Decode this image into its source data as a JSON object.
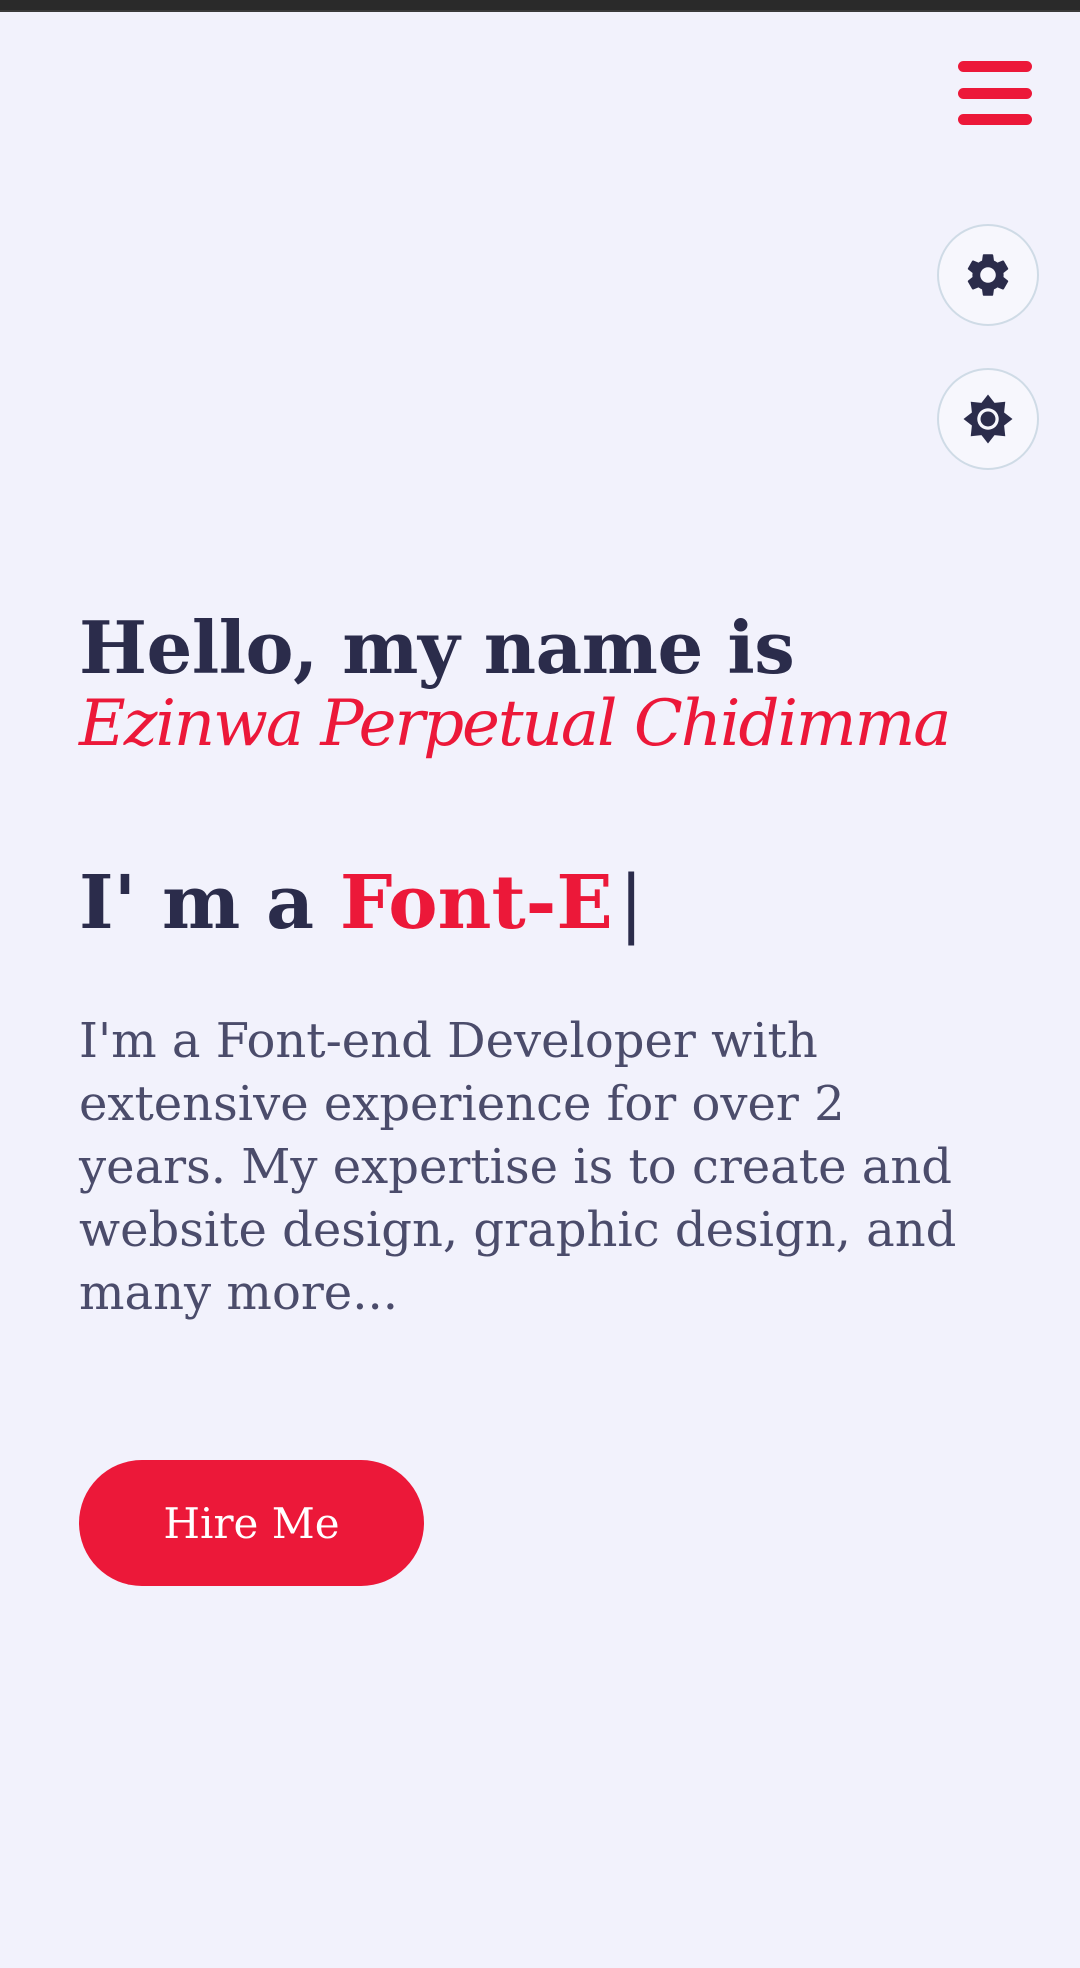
{
  "hero": {
    "greeting": "Hello, my name is ",
    "name": "Ezinwa Perpetual Chidimma",
    "role_prefix": "I' m a ",
    "role_typed": "Font-E",
    "role_cursor": "|",
    "description": "I'm a Font-end Developer with extensive experience for over 2 years. My expertise is to create and website design, graphic design, and many more...",
    "cta_label": "Hire Me"
  },
  "icons": {
    "menu": "hamburger-menu-icon",
    "settings": "gear-icon",
    "theme": "sun-icon"
  },
  "colors": {
    "background": "#f2f2fc",
    "accent": "#ec1839",
    "heading": "#2b2c4b",
    "body_text": "#4b4c6b"
  }
}
